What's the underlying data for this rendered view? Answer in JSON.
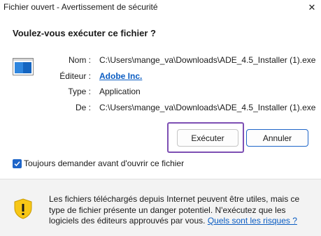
{
  "window": {
    "title": "Fichier ouvert - Avertissement de sécurité",
    "close_glyph": "✕"
  },
  "dialog": {
    "question": "Voulez-vous exécuter ce fichier ?",
    "fields": {
      "name_label": "Nom :",
      "name_value": "C:\\Users\\mange_va\\Downloads\\ADE_4.5_Installer (1).exe",
      "publisher_label": "Éditeur :",
      "publisher_value": "Adobe Inc.",
      "type_label": "Type :",
      "type_value": "Application",
      "from_label": "De :",
      "from_value": "C:\\Users\\mange_va\\Downloads\\ADE_4.5_Installer (1).exe"
    },
    "buttons": {
      "run_label": "Exécuter",
      "cancel_label": "Annuler"
    },
    "checkbox": {
      "label": "Toujours demander avant d'ouvrir ce fichier",
      "checked": true
    }
  },
  "warning": {
    "text": "Les fichiers téléchargés depuis Internet peuvent être utiles, mais ce type de fichier présente un danger potentiel. N'exécutez que les logiciels des éditeurs approuvés par vous.",
    "link_label": "Quels sont les risques ?"
  },
  "colors": {
    "link": "#0a5cc2",
    "accent": "#1e65c8",
    "highlight": "#7d4fb3",
    "shield": "#f7c716"
  },
  "icons": {
    "file": "application-window-icon",
    "warning": "shield-warning-icon",
    "checkbox": "checkmark-icon"
  }
}
